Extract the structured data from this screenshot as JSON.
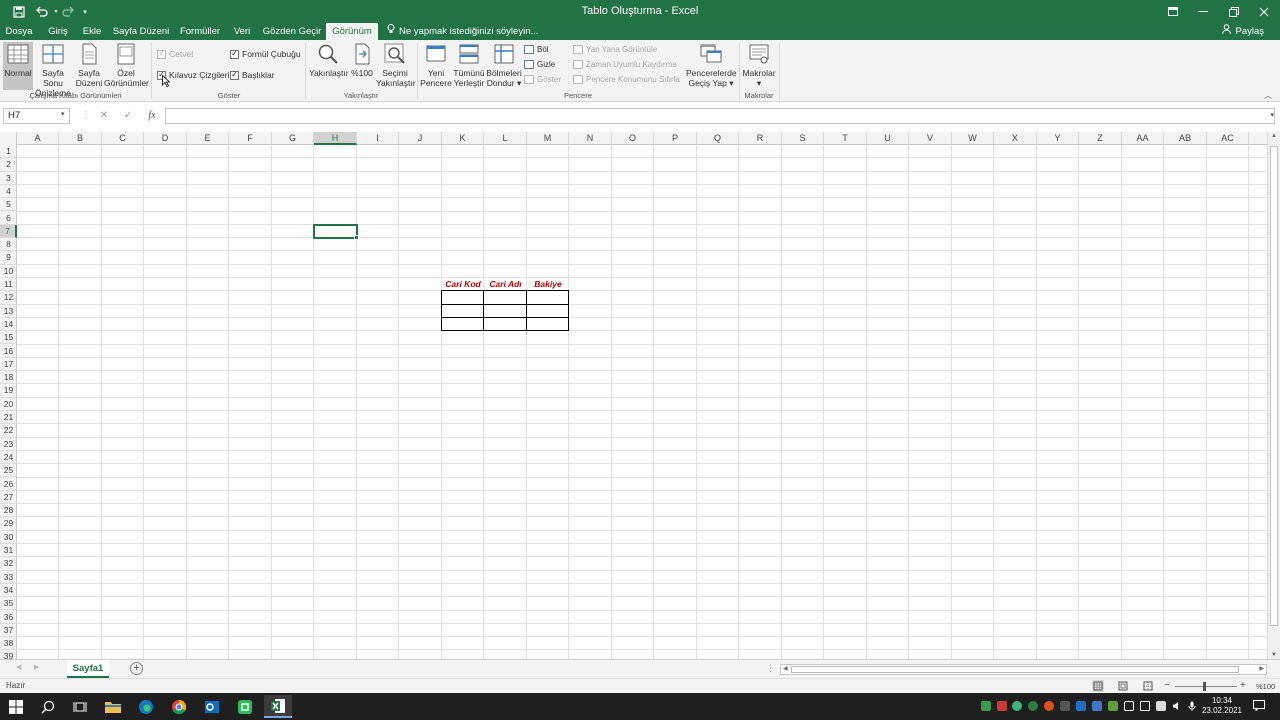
{
  "window": {
    "title": "Tablo Oluşturma - Excel"
  },
  "tabs": [
    {
      "label": "Dosya",
      "active": false
    },
    {
      "label": "Giriş",
      "active": false
    },
    {
      "label": "Ekle",
      "active": false
    },
    {
      "label": "Sayfa Düzeni",
      "active": false
    },
    {
      "label": "Formüller",
      "active": false
    },
    {
      "label": "Veri",
      "active": false
    },
    {
      "label": "Gözden Geçir",
      "active": false
    },
    {
      "label": "Görünüm",
      "active": true
    }
  ],
  "tell_me": "Ne yapmak istediğinizi söyleyin...",
  "share": "Paylaş",
  "ribbon": {
    "groups": {
      "views": "Çalışma Kitabı Görünümleri",
      "show": "Göster",
      "zoom": "Yakınlaştır",
      "window": "Pencere",
      "macros": "Makrolar"
    },
    "views": {
      "normal": "Normal",
      "page_break_1": "Sayfa Sonu",
      "page_break_2": "Önizleme",
      "page_layout_1": "Sayfa",
      "page_layout_2": "Düzeni",
      "custom_1": "Özel",
      "custom_2": "Görünümler"
    },
    "show": {
      "ruler": "Cetvel",
      "formula_bar": "Formül Çubuğu",
      "gridlines": "Kılavuz Çizgileri",
      "headings": "Başlıklar"
    },
    "zoom": {
      "zoom": "Yakınlaştır",
      "zoom100": "%100",
      "zoom_sel_1": "Seçimi",
      "zoom_sel_2": "Yakınlaştır"
    },
    "window": {
      "new_1": "Yeni",
      "new_2": "Pencere",
      "arrange_1": "Tümünü",
      "arrange_2": "Yerleştir",
      "freeze_1": "Bölmeleri",
      "freeze_2": "Dondur",
      "split": "Böl",
      "hide": "Gizle",
      "unhide": "Göster",
      "side_by_side": "Yan Yana Görüntüle",
      "sync_scroll": "Zaman Uyumlu Kaydırma",
      "reset_pos": "Pencere Konumunu Sıfırla",
      "switch_1": "Pencerelerde",
      "switch_2": "Geçiş Yap"
    },
    "macros": {
      "macros": "Makrolar"
    }
  },
  "formula_bar": {
    "name_box": "H7",
    "fx": "fx",
    "cancel": "✕",
    "confirm": "✓",
    "value": ""
  },
  "grid": {
    "columns": [
      "A",
      "B",
      "C",
      "D",
      "E",
      "F",
      "G",
      "H",
      "I",
      "J",
      "K",
      "L",
      "M",
      "N",
      "O",
      "P",
      "Q",
      "R",
      "S",
      "T",
      "U",
      "V",
      "W",
      "X",
      "Y",
      "Z",
      "AA",
      "AB",
      "AC"
    ],
    "rows": [
      "1",
      "2",
      "3",
      "4",
      "5",
      "6",
      "7",
      "8",
      "9",
      "10",
      "11",
      "12",
      "13",
      "14",
      "15",
      "16",
      "17",
      "18",
      "19",
      "20",
      "21",
      "22",
      "23",
      "24",
      "25",
      "26",
      "27",
      "28",
      "29",
      "30",
      "31",
      "32",
      "33",
      "34",
      "35",
      "36",
      "37",
      "38",
      "39"
    ],
    "active_col": "H",
    "active_row": "7",
    "table_headers": [
      "Cari Kod",
      "Cari Adı",
      "Bakiye"
    ],
    "table_header_color": "#c00000"
  },
  "sheet": {
    "tab": "Sayfa1"
  },
  "status": {
    "ready": "Hazır",
    "zoom": "%100"
  },
  "clock": {
    "time": "10:34",
    "date": "23.02.2021"
  },
  "accent": "#217346"
}
